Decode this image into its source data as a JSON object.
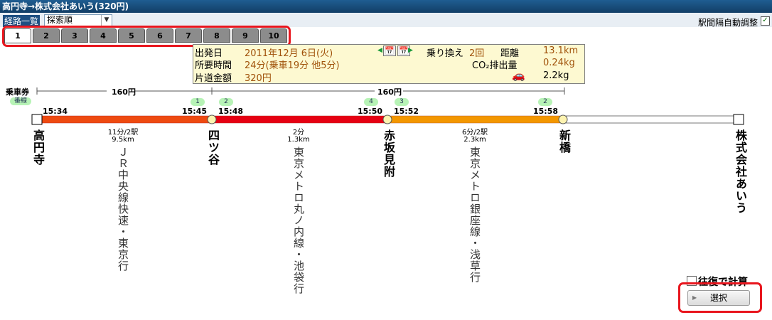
{
  "window": {
    "title": "高円寺→株式会社あいう(320円)"
  },
  "toolbar": {
    "route_list_label": "経路一覧",
    "sort_value": "探索順",
    "auto_adjust_label": "駅間隔自動調整",
    "auto_adjust_checked": "✓"
  },
  "tabs": [
    "1",
    "2",
    "3",
    "4",
    "5",
    "6",
    "7",
    "8",
    "9",
    "10"
  ],
  "info": {
    "depart_label": "出発日",
    "depart_value": "2011年12月 6日(火)",
    "duration_label": "所要時間",
    "duration_value": "24分(乗車19分 他5分)",
    "fare_label": "片道金額",
    "fare_value": "320円",
    "transfer_label": "乗り換え",
    "transfer_value": "2回",
    "distance_label": "距離",
    "distance_value": "13.1km",
    "co2_label": "CO₂排出量",
    "co2_value": "0.24kg",
    "car_value": "2.2kg"
  },
  "fare_bar": {
    "ticket_label": "乗車券",
    "platform_label": "番線",
    "segment1_price": "160円",
    "segment2_price": "160円"
  },
  "route": {
    "stations": [
      {
        "name": "高円寺",
        "depart": "15:34"
      },
      {
        "name": "四ツ谷",
        "arrive": "15:45",
        "depart": "15:48",
        "arrive_platform": "1",
        "depart_platform": "2"
      },
      {
        "name": "赤坂見附",
        "arrive": "15:50",
        "depart": "15:52",
        "arrive_platform": "4",
        "depart_platform": "3"
      },
      {
        "name": "新橋",
        "arrive": "15:58",
        "arrive_platform": "2"
      },
      {
        "name": "株式会社あいう"
      }
    ],
    "legs": [
      {
        "time": "11分/2駅",
        "distance": "9.5km",
        "line": "ＪＲ中央線快速・東京行",
        "color": "#ee4a10"
      },
      {
        "time": "2分",
        "distance": "1.3km",
        "line": "東京メトロ丸ノ内線・池袋行",
        "color": "#e60012"
      },
      {
        "time": "6分/2駅",
        "distance": "2.3km",
        "line": "東京メトロ銀座線・浅草行",
        "color": "#f39700"
      },
      {
        "time": "",
        "distance": "",
        "line": "",
        "color": "#ffffff"
      }
    ]
  },
  "footer": {
    "roundtrip_label": "往復で計算",
    "select_label": "選択"
  }
}
